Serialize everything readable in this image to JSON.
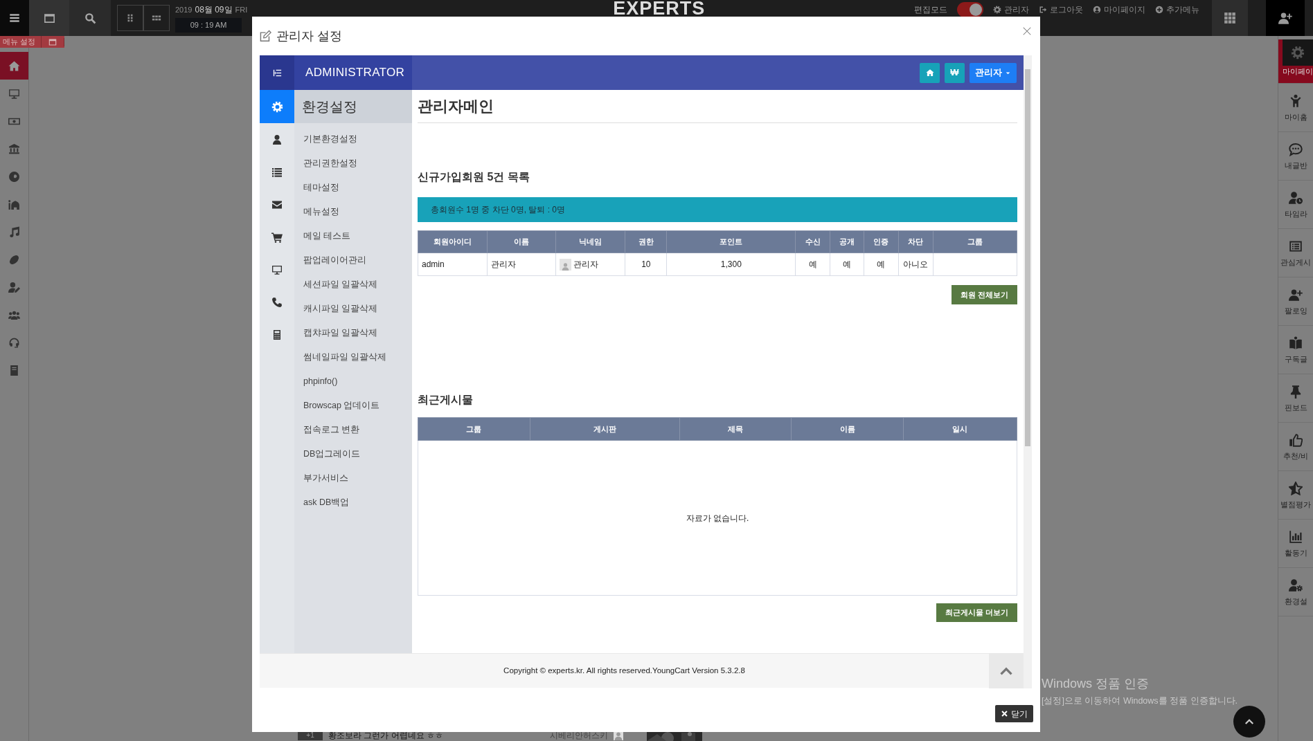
{
  "topbar": {
    "date_year": "2019",
    "date": "08월 09일",
    "weekday": "FRI",
    "time": "09 : 19 AM",
    "logo": "EXPERTS",
    "edit_mode": {
      "label": "편집모드",
      "on": true
    },
    "links": [
      "관리자",
      "로그아웃",
      "마이페이지",
      "추가메뉴"
    ]
  },
  "menu_tab": "메뉴 설정",
  "left_nav": [
    {
      "selected": true
    },
    {
      "selected": false
    },
    {
      "selected": false
    },
    {
      "selected": false
    },
    {
      "selected": false
    },
    {
      "selected": false
    },
    {
      "selected": false
    },
    {
      "selected": false
    },
    {
      "selected": false
    },
    {
      "selected": false
    },
    {
      "selected": false
    },
    {
      "selected": false
    }
  ],
  "right_nav": [
    {
      "label": "마이페이",
      "selected": true
    },
    {
      "label": "마이홈",
      "selected": false
    },
    {
      "label": "내글반",
      "selected": false
    },
    {
      "label": "타임라",
      "selected": false
    },
    {
      "label": "관심게시",
      "selected": false
    },
    {
      "label": "팔로잉",
      "selected": false
    },
    {
      "label": "구독글",
      "selected": false
    },
    {
      "label": "핀보드",
      "selected": false
    },
    {
      "label": "추천/비",
      "selected": false
    },
    {
      "label": "별점평가",
      "selected": false
    },
    {
      "label": "활동기",
      "selected": false
    },
    {
      "label": "환경설",
      "selected": false
    }
  ],
  "modal": {
    "title": "관리자 설정",
    "close_button": "닫기",
    "admin": {
      "brand": "ADMINISTRATOR",
      "currency_button": "₩",
      "user_menu": "관리자",
      "icon_tabs": [
        {
          "selected": true
        },
        {
          "selected": false
        },
        {
          "selected": false
        },
        {
          "selected": false
        },
        {
          "selected": false
        },
        {
          "selected": false
        },
        {
          "selected": false
        },
        {
          "selected": false
        }
      ],
      "section_title": "환경설정",
      "menu": [
        "기본환경설정",
        "관리권한설정",
        "테마설정",
        "메뉴설정",
        "메일 테스트",
        "팝업레이어관리",
        "세션파일 일괄삭제",
        "캐시파일 일괄삭제",
        "캡챠파일 일괄삭제",
        "썸네일파일 일괄삭제",
        "phpinfo()",
        "Browscap 업데이트",
        "접속로그 변환",
        "DB업그레이드",
        "부가서비스",
        "ask DB백업"
      ],
      "page_title": "관리자메인",
      "members": {
        "title": "신규가입회원 5건 목록",
        "summary": "총회원수 1명 중 차단 0명, 탈퇴 : 0명",
        "columns": [
          "회원아이디",
          "이름",
          "닉네임",
          "권한",
          "포인트",
          "수신",
          "공개",
          "인증",
          "차단",
          "그룹"
        ],
        "rows": [
          {
            "cells": [
              "admin",
              "관리자",
              "관리자",
              "10",
              "1,300",
              "예",
              "예",
              "예",
              "아니오"
            ]
          }
        ],
        "button": "회원 전체보기"
      },
      "posts": {
        "title": "최근게시물",
        "columns": [
          "그룹",
          "게시판",
          "제목",
          "이름",
          "일시"
        ],
        "empty_message": "자료가 없습니다.",
        "button": "최근게시물 더보기"
      },
      "footer": "Copyright © experts.kr. All rights reserved.YoungCart Version 5.3.2.8"
    }
  },
  "background_post": {
    "badge": "+1",
    "text": "황조보라 그런가 어렵네요 ㅎㅎ",
    "author": "시베리안허스키"
  },
  "os_notice": {
    "title": "Windows 정품 인증",
    "text": "[설정]으로 이동하여 Windows를 정품 인증합니다."
  }
}
